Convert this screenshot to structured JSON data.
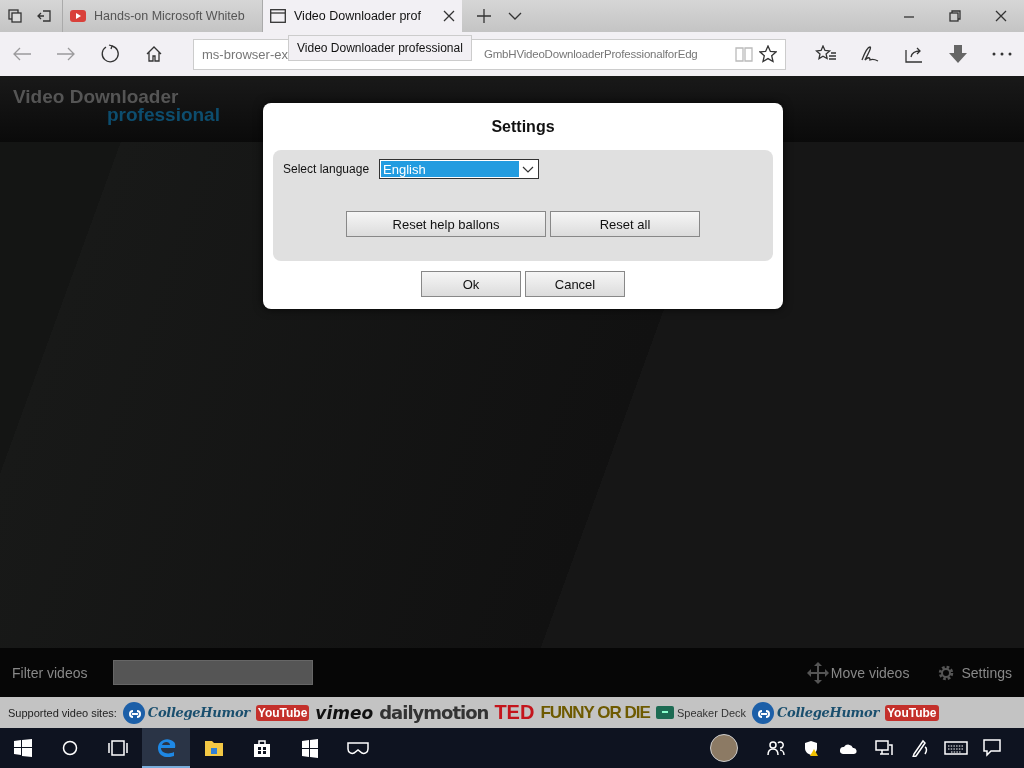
{
  "tabs": [
    {
      "title": "Hands-on Microsoft Whiteb",
      "selected": false
    },
    {
      "title": "Video Downloader prof",
      "selected": true
    }
  ],
  "tooltip": "Video Downloader professional",
  "address": {
    "shown_start": "ms-browser-ex",
    "shown_end": "GmbHVideoDownloaderProfessionalforEdg"
  },
  "app": {
    "logo_line1": "Video Downloader",
    "logo_line2": "professional",
    "filter_label": "Filter videos",
    "move_videos": "Move videos",
    "settings": "Settings",
    "supported_label": "Supported video sites:",
    "sites": [
      {
        "name": "CollegeHumor",
        "kind": "collegehumor"
      },
      {
        "name": "YouTube",
        "kind": "youtube"
      },
      {
        "name": "vimeo",
        "kind": "vimeo"
      },
      {
        "name": "dailymotion",
        "kind": "dailymotion"
      },
      {
        "name": "TED",
        "kind": "ted"
      },
      {
        "name": "FUNNY OR DIE",
        "kind": "funnyordie"
      },
      {
        "name": "Speaker Deck",
        "kind": "speakerdeck"
      },
      {
        "name": "CollegeHumor",
        "kind": "collegehumor"
      },
      {
        "name": "YouTube",
        "kind": "youtube"
      }
    ]
  },
  "dialog": {
    "title": "Settings",
    "language_label": "Select language",
    "language": "English",
    "reset_buttons": [
      "Reset help ballons",
      "Reset all"
    ],
    "buttons": [
      "Ok",
      "Cancel"
    ]
  }
}
